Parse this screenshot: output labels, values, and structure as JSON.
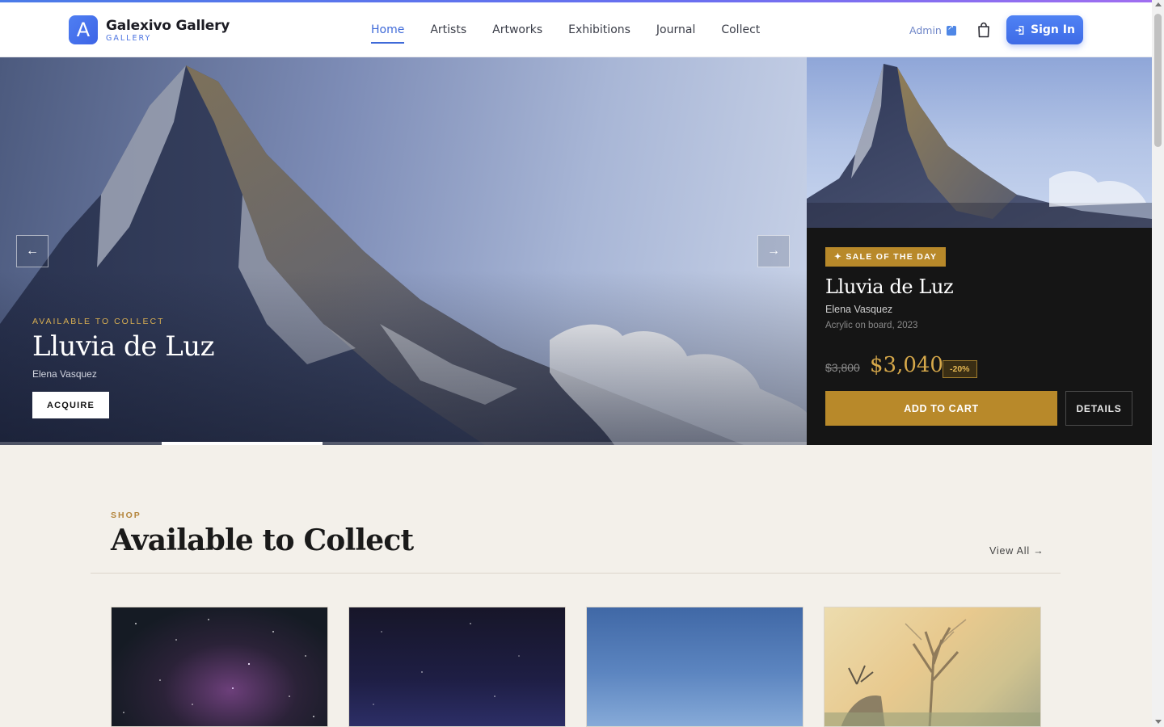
{
  "header": {
    "logo_letter": "A",
    "brand_name": "Galexivo Gallery",
    "brand_sub": "GALLERY",
    "nav": [
      "Home",
      "Artists",
      "Artworks",
      "Exhibitions",
      "Journal",
      "Collect"
    ],
    "active_nav": "Home",
    "admin_label": "Admin",
    "signin_label": "Sign In"
  },
  "hero": {
    "kicker": "AVAILABLE TO COLLECT",
    "title": "Lluvia de Luz",
    "artist": "Elena Vasquez",
    "cta": "ACQUIRE",
    "prev_arrow": "←",
    "next_arrow": "→",
    "slide_index": 2,
    "slide_count": 5
  },
  "sale": {
    "badge": "✦ SALE OF THE DAY",
    "title": "Lluvia de Luz",
    "artist": "Elena Vasquez",
    "medium": "Acrylic on board, 2023",
    "price_old": "$3,800",
    "price_new": "$3,040",
    "discount": "-20%",
    "add_to_cart": "ADD TO CART",
    "details": "DETAILS"
  },
  "shop": {
    "kicker": "SHOP",
    "title": "Available to Collect",
    "view_all": "View All →"
  },
  "colors": {
    "accent": "#3f6ad8",
    "gold": "#b8892a",
    "dark_panel": "#151515",
    "page_bg": "#f3f0ea"
  }
}
